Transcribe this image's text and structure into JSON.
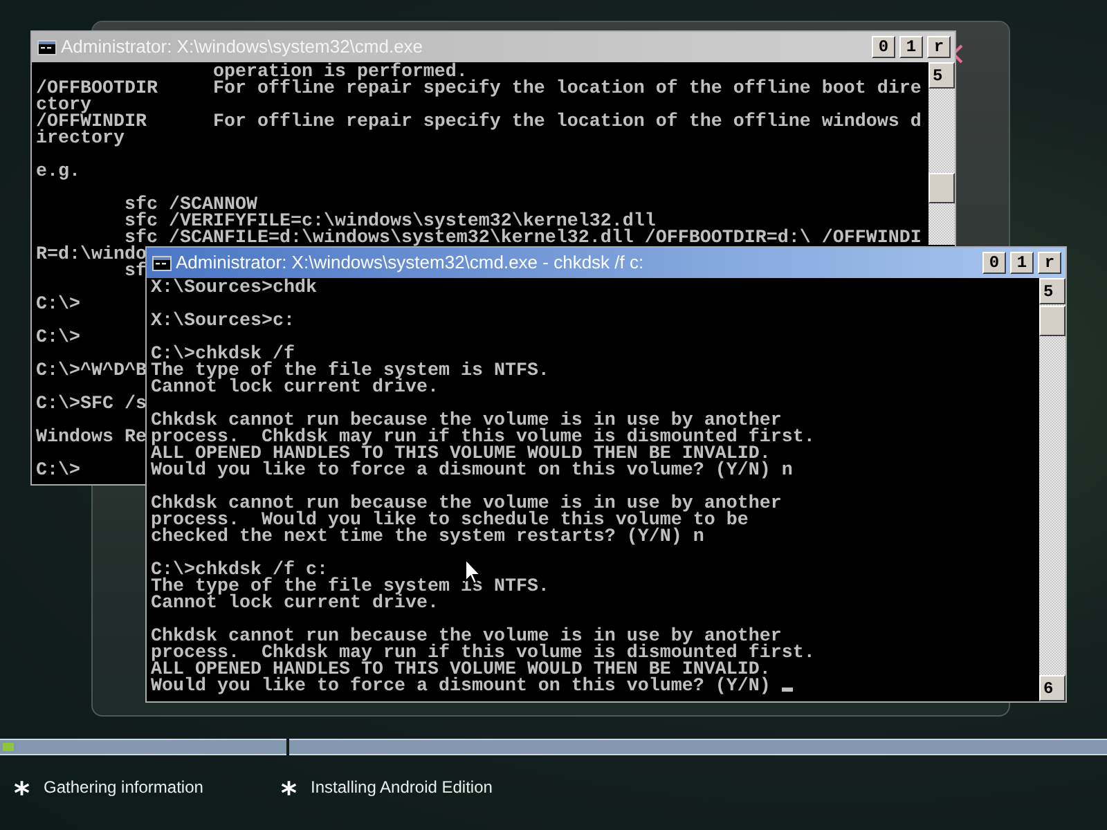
{
  "windows": [
    {
      "title": "Administrator: X:\\windows\\system32\\cmd.exe",
      "active": false,
      "title_buttons": [
        "0",
        "1",
        "r"
      ],
      "scrollbar": {
        "up": "5"
      },
      "text_cursor": false,
      "blocks": [
        [
          "                operation is performed.",
          "/OFFBOOTDIR     For offline repair specify the location of the offline boot dire",
          "ctory",
          "/OFFWINDIR      For offline repair specify the location of the offline windows d",
          "irectory"
        ],
        [
          "e.g."
        ],
        [
          "        sfc /SCANNOW",
          "        sfc /VERIFYFILE=c:\\windows\\system32\\kernel32.dll",
          "        sfc /SCANFILE=d:\\windows\\system32\\kernel32.dll /OFFBOOTDIR=d:\\ /OFFWINDI",
          "R=d:\\windo",
          "        sf"
        ],
        [
          "C:\\>"
        ],
        [
          "C:\\>"
        ],
        [
          "C:\\>^W^D^B"
        ],
        [
          "C:\\>SFC /s"
        ],
        [
          "Windows Re"
        ],
        [
          "C:\\>"
        ]
      ]
    },
    {
      "title": "Administrator: X:\\windows\\system32\\cmd.exe - chkdsk  /f c:",
      "active": true,
      "title_buttons": [
        "0",
        "1",
        "r"
      ],
      "scrollbar": {
        "up": "5",
        "down": "6"
      },
      "text_cursor": true,
      "blocks": [
        [
          "X:\\Sources>chdk"
        ],
        [
          "X:\\Sources>c:"
        ],
        [
          "C:\\>chkdsk /f",
          "The type of the file system is NTFS.",
          "Cannot lock current drive."
        ],
        [
          "Chkdsk cannot run because the volume is in use by another",
          "process.  Chkdsk may run if this volume is dismounted first.",
          "ALL OPENED HANDLES TO THIS VOLUME WOULD THEN BE INVALID.",
          "Would you like to force a dismount on this volume? (Y/N) n"
        ],
        [
          "Chkdsk cannot run because the volume is in use by another",
          "process.  Would you like to schedule this volume to be",
          "checked the next time the system restarts? (Y/N) n"
        ],
        [
          "C:\\>chkdsk /f c:",
          "The type of the file system is NTFS.",
          "Cannot lock current drive."
        ],
        [
          "Chkdsk cannot run because the volume is in use by another",
          "process.  Chkdsk may run if this volume is dismounted first.",
          "ALL OPENED HANDLES TO THIS VOLUME WOULD THEN BE INVALID.",
          "Would you like to force a dismount on this volume? (Y/N)"
        ]
      ]
    }
  ],
  "progress": [
    {
      "level": 0.04
    },
    {
      "level": 0
    }
  ],
  "steps": [
    {
      "marker": "*",
      "label": "Gathering information"
    },
    {
      "marker": "*",
      "label": "Installing Android Edition"
    }
  ]
}
